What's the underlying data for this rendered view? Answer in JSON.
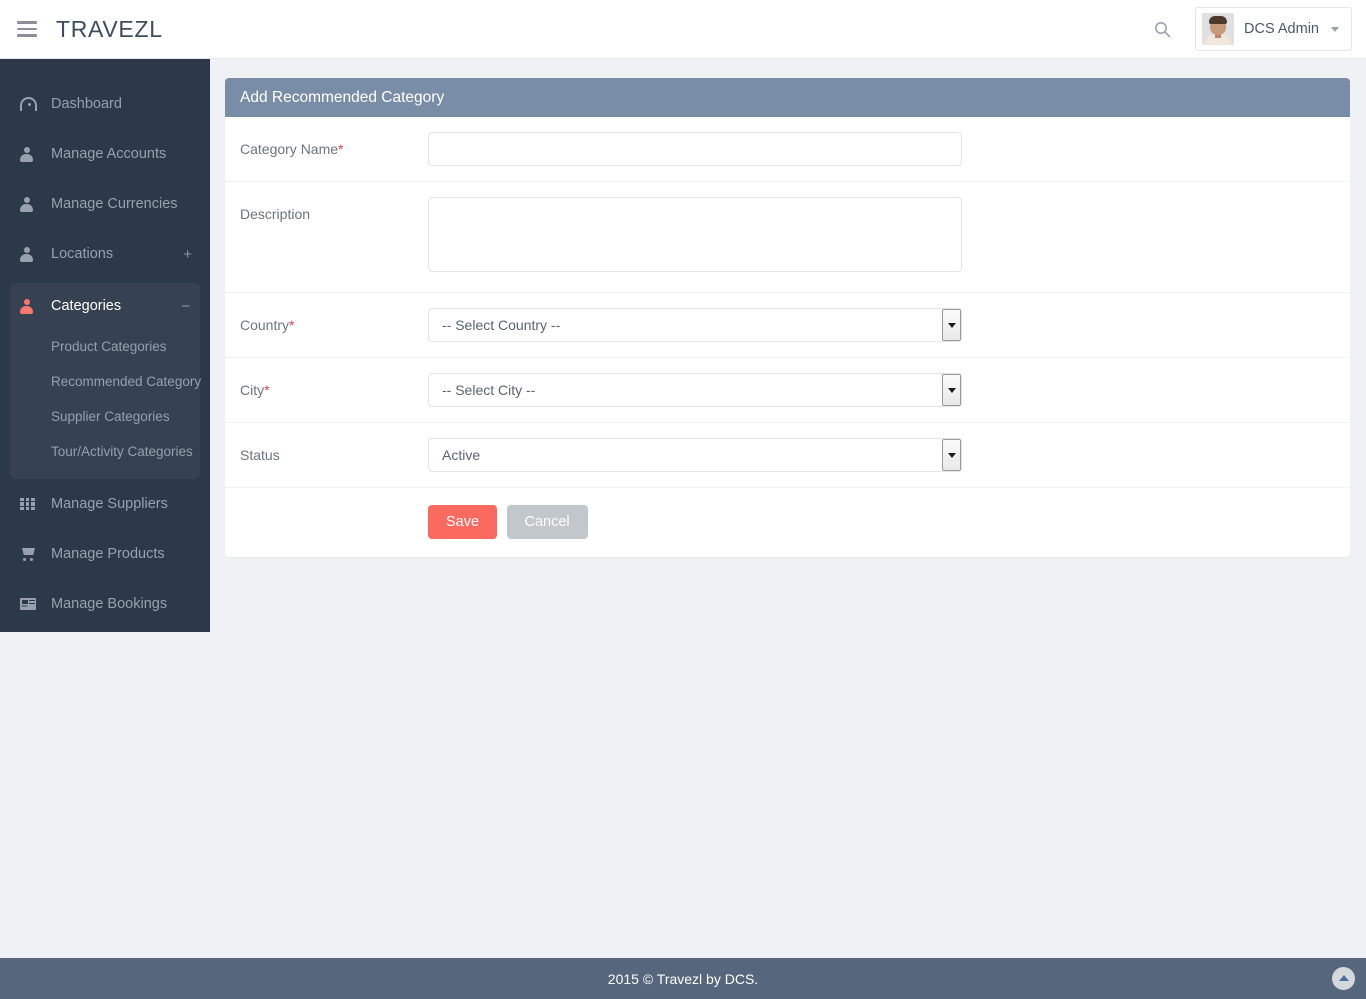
{
  "header": {
    "brand": "TRAVEZL",
    "menu_icon": "hamburger-icon",
    "search_icon": "search-icon",
    "user_name": "DCS Admin"
  },
  "sidebar": {
    "items": [
      {
        "label": "Dashboard",
        "icon": "gauge-icon",
        "expander": ""
      },
      {
        "label": "Manage Accounts",
        "icon": "person-icon",
        "expander": ""
      },
      {
        "label": "Manage Currencies",
        "icon": "person-icon",
        "expander": ""
      },
      {
        "label": "Locations",
        "icon": "person-icon",
        "expander": "+"
      },
      {
        "label": "Categories",
        "icon": "person-icon",
        "expander": "−"
      },
      {
        "label": "Manage Suppliers",
        "icon": "grid-icon",
        "expander": ""
      },
      {
        "label": "Manage Products",
        "icon": "cart-icon",
        "expander": ""
      },
      {
        "label": "Manage Bookings",
        "icon": "news-icon",
        "expander": ""
      }
    ],
    "categories_submenu": [
      {
        "label": "Product Categories"
      },
      {
        "label": "Recommended Category"
      },
      {
        "label": "Supplier Categories"
      },
      {
        "label": "Tour/Activity Categories"
      }
    ],
    "accent_color": "#f9776c"
  },
  "panel": {
    "title": "Add Recommended Category",
    "fields": {
      "category_name": {
        "label": "Category Name",
        "required": "*",
        "value": "",
        "placeholder": ""
      },
      "description": {
        "label": "Description",
        "required": "",
        "value": "",
        "placeholder": ""
      },
      "country": {
        "label": "Country",
        "required": "*",
        "value": "-- Select Country --"
      },
      "city": {
        "label": "City",
        "required": "*",
        "value": "-- Select City --"
      },
      "status": {
        "label": "Status",
        "required": "",
        "value": "Active"
      }
    },
    "buttons": {
      "save": "Save",
      "cancel": "Cancel"
    }
  },
  "footer": {
    "text": "2015 © Travezl by DCS.",
    "to_top_icon": "chevron-up-icon"
  }
}
